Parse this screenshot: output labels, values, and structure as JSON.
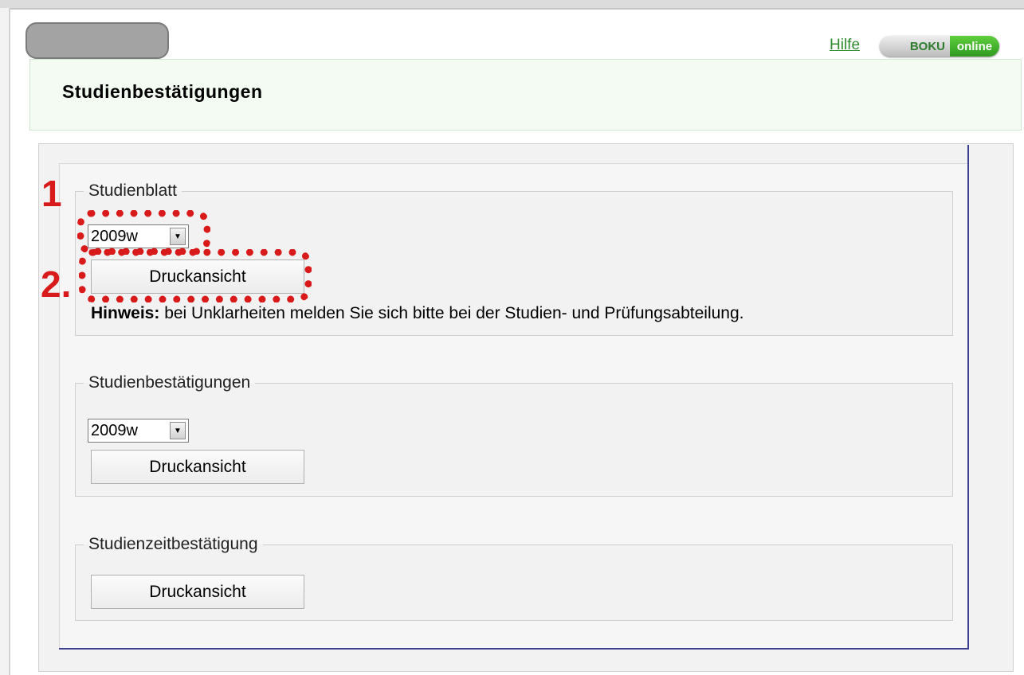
{
  "header": {
    "help_label": "Hilfe",
    "logo_left": "BOKU",
    "logo_right": "online",
    "page_title": "Studienbestätigungen"
  },
  "sections": [
    {
      "legend": "Studienblatt",
      "selected_semester": "2009w",
      "button_label": "Druckansicht",
      "hint_label": "Hinweis:",
      "hint_text": " bei Unklarheiten melden Sie sich bitte bei der Studien- und Prüfungsabteilung."
    },
    {
      "legend": "Studienbestätigungen",
      "selected_semester": "2009w",
      "button_label": "Druckansicht"
    },
    {
      "legend": "Studienzeitbestätigung",
      "button_label": "Druckansicht"
    }
  ],
  "annotations": {
    "step1": "1",
    "step2": "2.",
    "color": "#d91a1a"
  },
  "colors": {
    "accent_green": "#2e8b2e",
    "panel_rule": "#3f3f8f"
  },
  "icons": {
    "dropdown": "chevron-down-icon"
  }
}
